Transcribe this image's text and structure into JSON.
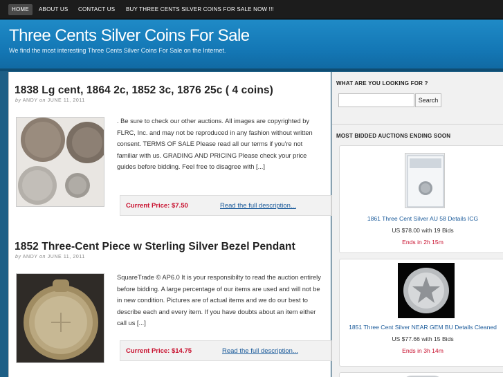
{
  "nav": {
    "items": [
      {
        "label": "HOME"
      },
      {
        "label": "ABOUT US"
      },
      {
        "label": "CONTACT US"
      },
      {
        "label": "BUY THREE CENTS SILVER COINS FOR SALE NOW !!!"
      }
    ]
  },
  "header": {
    "title": "Three Cents Silver Coins For Sale",
    "tagline": "We find the most interesting Three Cents Silver Coins For Sale on the Internet."
  },
  "posts": [
    {
      "title": "1838 Lg cent, 1864 2c, 1852 3c, 1876 25c ( 4 coins)",
      "by": "by",
      "author": "ANDY",
      "on": "on",
      "date": "JUNE 11, 2011",
      "excerpt": ". Be sure to check our other auctions. All images are copyrighted by FLRC, Inc. and may not be reproduced in any fashion without written consent. TERMS OF SALE Please read all our terms if you're not familiar with us. GRADING AND PRICING Please check your price guides before bidding. Feel free to disagree with [...]",
      "price": "Current Price: $7.50",
      "read_more": "Read the full description..."
    },
    {
      "title": "1852 Three-Cent Piece w Sterling Silver Bezel Pendant",
      "by": "by",
      "author": "ANDY",
      "on": "on",
      "date": "JUNE 11, 2011",
      "excerpt": "SquareTrade © AP6.0 It is your responsibilty to read the auction entirely before bidding. A large percentage of our items are used and will not be in new condition. Pictures are of actual items and we do our best to describe each and every item. If you have doubts about an item either call us [...]",
      "price": "Current Price: $14.75",
      "read_more": "Read the full description..."
    }
  ],
  "sidebar": {
    "search_title": "WHAT ARE YOU LOOKING FOR ?",
    "search_placeholder": "",
    "search_button": "Search",
    "auctions_title": "MOST BIDDED AUCTIONS ENDING SOON",
    "auctions": [
      {
        "title": "1861 Three Cent Silver AU 58 Details ICG",
        "price": "US $78.00 with 19 Bids",
        "ends": "Ends in 2h 15m"
      },
      {
        "title": "1851 Three Cent Silver NEAR GEM BU Details Cleaned",
        "price": "US $77.66 with 15 Bids",
        "ends": "Ends in 3h 14m"
      }
    ]
  },
  "colors": {
    "header_blue": "#1478b6",
    "price_red": "#c8102e",
    "link_blue": "#1a5a9a",
    "nav_bg": "#1c1c1c"
  }
}
